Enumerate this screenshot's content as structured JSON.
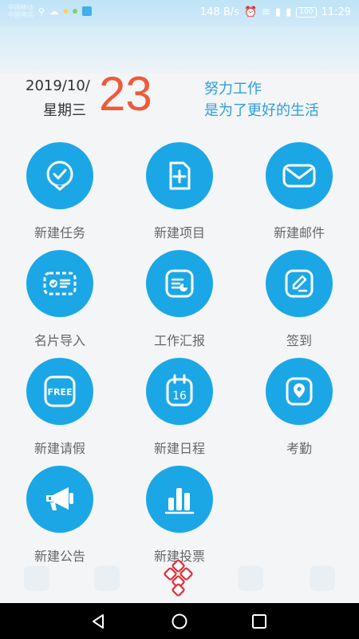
{
  "status": {
    "carrier1": "中国移动",
    "carrier2": "中国电信",
    "speed": "148 B/s",
    "battery": "100",
    "time": "11:29"
  },
  "date": {
    "ymd": "2019/10/",
    "weekday": "星期三",
    "day": "23"
  },
  "slogan": {
    "line1": "努力工作",
    "line2": "是为了更好的生活"
  },
  "tiles": [
    {
      "label": "新建任务",
      "icon": "task-check-icon"
    },
    {
      "label": "新建项目",
      "icon": "new-project-doc-icon"
    },
    {
      "label": "新建邮件",
      "icon": "mail-envelope-icon"
    },
    {
      "label": "名片导入",
      "icon": "business-card-import-icon"
    },
    {
      "label": "工作汇报",
      "icon": "work-report-icon"
    },
    {
      "label": "签到",
      "icon": "sign-in-pen-icon"
    },
    {
      "label": "新建请假",
      "icon": "free-leave-icon",
      "icon_text": "FREE"
    },
    {
      "label": "新建日程",
      "icon": "calendar-schedule-icon",
      "icon_text": "16"
    },
    {
      "label": "考勤",
      "icon": "attendance-location-icon"
    },
    {
      "label": "新建公告",
      "icon": "megaphone-announcement-icon"
    },
    {
      "label": "新建投票",
      "icon": "vote-bar-chart-icon"
    }
  ],
  "colors": {
    "accent": "#1ba7e6",
    "date_number": "#ef5a3a",
    "slogan": "#2f9fdc"
  }
}
